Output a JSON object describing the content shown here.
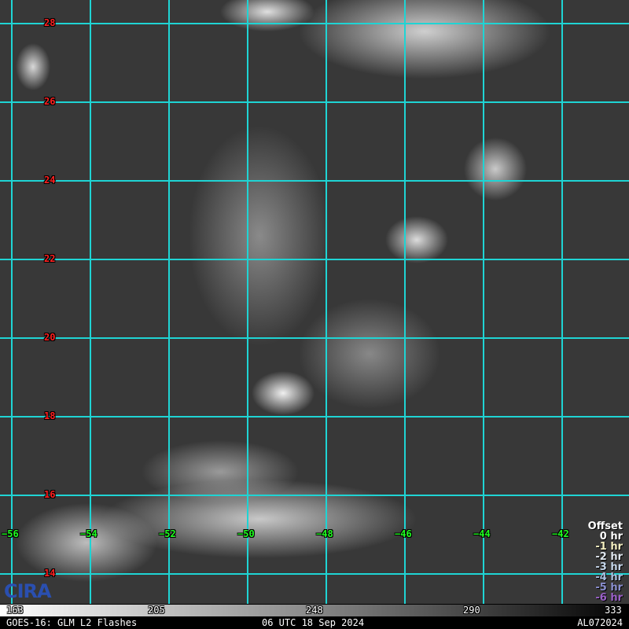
{
  "map": {
    "latitudes": [
      "28",
      "26",
      "24",
      "22",
      "20",
      "18",
      "16",
      "14"
    ],
    "longitudes": [
      "−56",
      "−54",
      "−52",
      "−50",
      "−48",
      "−46",
      "−44",
      "−42"
    ]
  },
  "legend": {
    "title": "Offset",
    "items": [
      {
        "label": "0 hr",
        "color": "#ffffff"
      },
      {
        "label": "-1 hr",
        "color": "#f3efc0"
      },
      {
        "label": "-2 hr",
        "color": "#dfe6ee"
      },
      {
        "label": "-3 hr",
        "color": "#c5d6ea"
      },
      {
        "label": "-4 hr",
        "color": "#a8bfe0"
      },
      {
        "label": "-5 hr",
        "color": "#8a8fd0"
      },
      {
        "label": "-6 hr",
        "color": "#9a60c8"
      }
    ]
  },
  "colorbar": {
    "ticks": [
      "163",
      "205",
      "248",
      "290",
      "333"
    ]
  },
  "footer": {
    "left": "GOES-16: GLM L2 Flashes",
    "center": "06 UTC 18 Sep 2024",
    "right": "AL072024"
  },
  "logo": "CIRA"
}
